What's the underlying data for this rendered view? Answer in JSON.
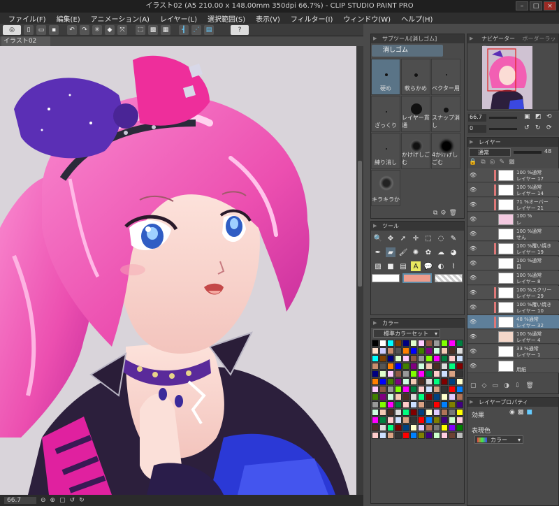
{
  "window": {
    "title": "イラスト02 (A5 210.00 x 148.00mm 350dpi 66.7%)  - CLIP STUDIO PAINT PRO",
    "minimize": "–",
    "maximize": "□",
    "close": "×"
  },
  "menu": [
    "ファイル(F)",
    "編集(E)",
    "アニメーション(A)",
    "レイヤー(L)",
    "選択範囲(S)",
    "表示(V)",
    "フィルター(I)",
    "ウィンドウ(W)",
    "ヘルプ(H)"
  ],
  "document_tab": "イラスト02",
  "status": {
    "zoom": "66.7"
  },
  "subtool": {
    "header": "サブツール[消しゴム]",
    "group": "消しゴム",
    "brushes": [
      "硬め",
      "軟らかめ",
      "ベクター用",
      "ざっくり",
      "レイヤー貫通",
      "スナップ消し",
      "練り消し",
      "かけげしごむ",
      "4かけげしごむ",
      "キラキラか"
    ]
  },
  "tool": {
    "header": "ツール"
  },
  "colorset": {
    "header": "カラー",
    "set_name": "標準カラーセット"
  },
  "navigator": {
    "tab1": "ナビゲーター",
    "tab2": "ボーダーラック",
    "zoom": "66.7"
  },
  "layers": {
    "header": "レイヤー",
    "blend": "通常",
    "opacity": "48",
    "rows": [
      {
        "l1": "100 %通常",
        "l2": "レイヤー 17",
        "mark": true,
        "thumb": "#ffffff"
      },
      {
        "l1": "100 %通常",
        "l2": "レイヤー 14",
        "mark": true,
        "thumb": "#ffffff"
      },
      {
        "l1": "71 %オーバー",
        "l2": "レイヤー 21",
        "mark": true,
        "thumb": "#ffffff"
      },
      {
        "l1": "100 %",
        "l2": "レ",
        "mark": false,
        "thumb": "#f3c9e0"
      },
      {
        "l1": "100 %通常",
        "l2": "せん",
        "mark": false,
        "thumb": "#ffffff"
      },
      {
        "l1": "100 %覆い焼き",
        "l2": "レイヤー 19",
        "mark": true,
        "thumb": "#ffffff"
      },
      {
        "l1": "100 %通常",
        "l2": "目",
        "mark": false,
        "thumb": "#ffffff"
      },
      {
        "l1": "100 %通常",
        "l2": "レイヤー 8",
        "mark": false,
        "thumb": "#ffffff"
      },
      {
        "l1": "100 %スクリー",
        "l2": "レイヤー 29",
        "mark": true,
        "thumb": "#ffffff"
      },
      {
        "l1": "100 %覆い焼き",
        "l2": "レイヤー 10",
        "mark": true,
        "thumb": "#ffffff"
      },
      {
        "l1": "48 %通常",
        "l2": "レイヤー 32",
        "mark": true,
        "thumb": "#ffffff",
        "selected": true
      },
      {
        "l1": "100 %通常",
        "l2": "レイヤー 4",
        "mark": false,
        "thumb": "#f4d7c9"
      },
      {
        "l1": "33 %通常",
        "l2": "レイヤー 1",
        "mark": false,
        "thumb": "#ffffff"
      },
      {
        "l1": "",
        "l2": "用紙",
        "mark": false,
        "thumb": "#ffffff"
      }
    ]
  },
  "layer_property": {
    "header": "レイヤープロパティ",
    "effect": "効果",
    "expression": "表現色",
    "color_mode": "カラー"
  },
  "colors": {
    "canvas_bg": "#d9d4da",
    "accent_blue": "#5b6f7e",
    "selected_layer": "#5e7f9a",
    "hair": "#f25fb3",
    "bow": "#5b2fb5"
  }
}
